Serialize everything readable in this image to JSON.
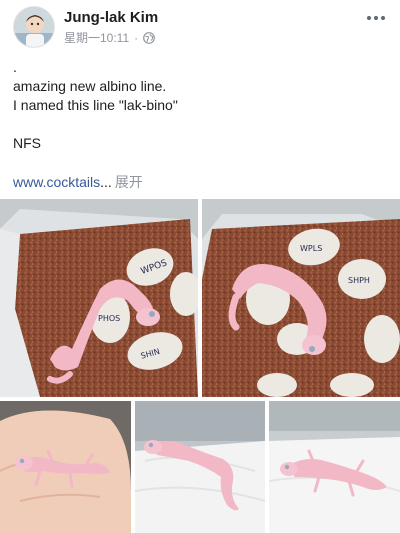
{
  "post": {
    "author": "Jung-lak Kim",
    "timestamp": "星期一10:11",
    "privacy_icon": "globe-icon",
    "more_icon": "more-options-icon"
  },
  "body": {
    "lines": [
      ".",
      "amazing new albino line.",
      "I named this line \"lak-bino\"",
      "",
      "NFS"
    ],
    "link_text": "www.cocktails",
    "ellipsis": "...",
    "expand_label": "展开"
  },
  "photos": {
    "egg_labels": [
      "WPOS",
      "PHOS",
      "SHIN",
      "WPLS",
      "SHPH"
    ],
    "count": 5
  },
  "colors": {
    "link": "#385898",
    "secondary_text": "#90949c",
    "gecko_pink": "#f2b8c6",
    "substrate": "#8a4a32"
  }
}
